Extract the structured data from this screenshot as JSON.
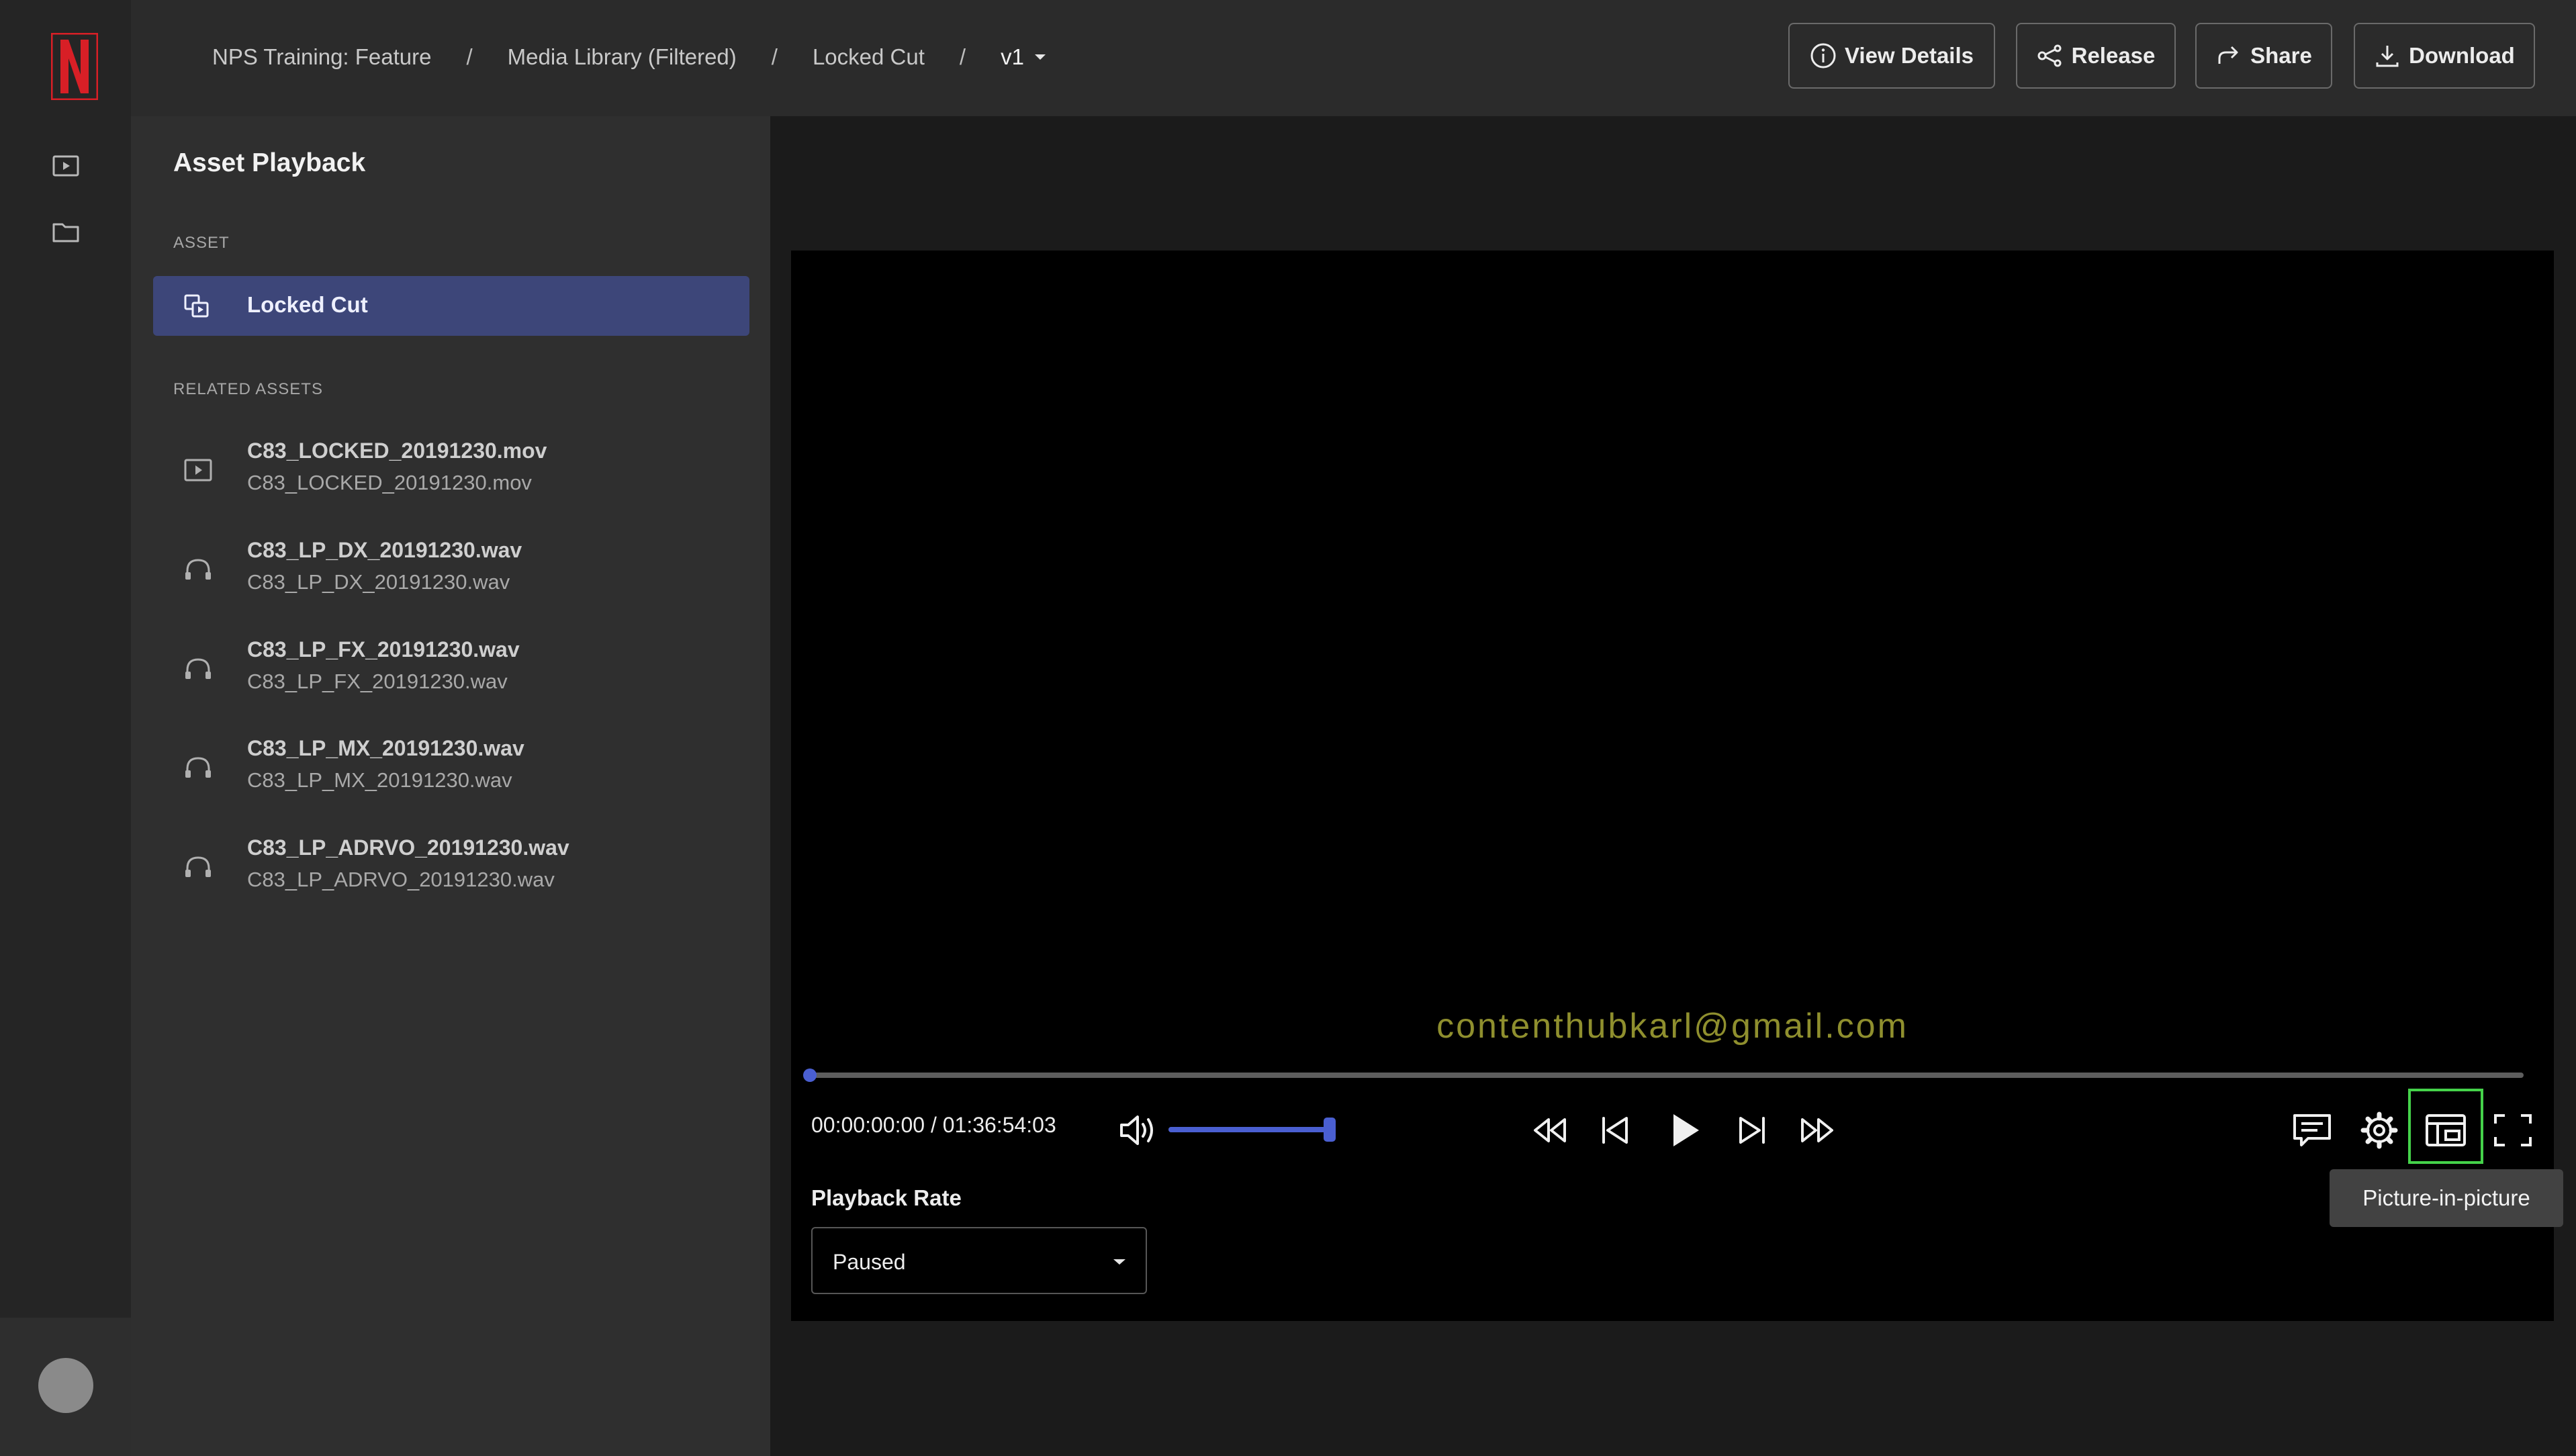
{
  "app": {
    "brand_letter": "N",
    "accent_color": "#4a5fd1",
    "selected_color": "#3d4679",
    "brand_color": "#d81f26"
  },
  "nav": {
    "rail_icons": [
      "play-media-icon",
      "folder-icon"
    ]
  },
  "header": {
    "breadcrumb": [
      "NPS Training: Feature",
      "Media Library (Filtered)",
      "Locked Cut"
    ],
    "separator": "/",
    "version": "v1",
    "actions": {
      "view_details": "View Details",
      "release": "Release",
      "share": "Share",
      "download": "Download"
    }
  },
  "panel": {
    "title": "Asset Playback",
    "asset_section": "ASSET",
    "asset": {
      "label": "Locked Cut",
      "icon": "multi-asset-icon"
    },
    "related_section": "RELATED ASSETS",
    "related": [
      {
        "name": "C83_LOCKED_20191230.mov",
        "file": "C83_LOCKED_20191230.mov",
        "icon": "video-file-icon"
      },
      {
        "name": "C83_LP_DX_20191230.wav",
        "file": "C83_LP_DX_20191230.wav",
        "icon": "headphones-icon"
      },
      {
        "name": "C83_LP_FX_20191230.wav",
        "file": "C83_LP_FX_20191230.wav",
        "icon": "headphones-icon"
      },
      {
        "name": "C83_LP_MX_20191230.wav",
        "file": "C83_LP_MX_20191230.wav",
        "icon": "headphones-icon"
      },
      {
        "name": "C83_LP_ADRVO_20191230.wav",
        "file": "C83_LP_ADRVO_20191230.wav",
        "icon": "headphones-icon"
      }
    ]
  },
  "player": {
    "watermark": "contenthubkarl@gmail.com",
    "timecode": "00:00:00:00 / 01:36:54:03",
    "progress": 0.0,
    "volume": 1.0,
    "tooltip": "Picture-in-picture",
    "playback_rate_label": "Playback Rate",
    "playback_rate_value": "Paused"
  }
}
